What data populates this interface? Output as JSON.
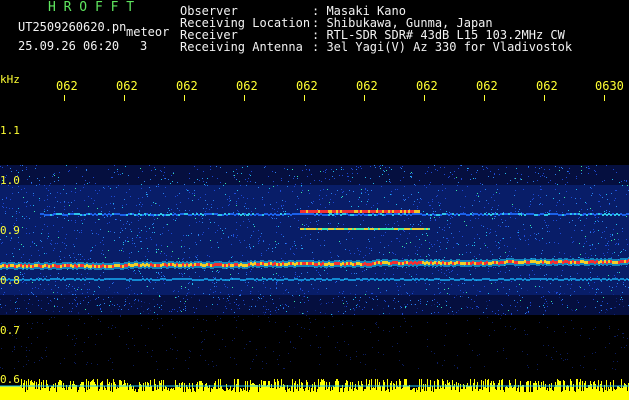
{
  "app_title": "H R O F F T",
  "file_name": "UT2509260620.pn",
  "mode_label": "meteor",
  "date_time": "25.09.26 06:20",
  "count_label": "3",
  "info_labels": [
    "Observer",
    "Receiving Location",
    "Receiver",
    "Receiving Antenna"
  ],
  "info_values": [
    ": Masaki Kano",
    ": Shibukawa, Gunma, Japan",
    ": RTL-SDR SDR# 43dB L15 103.2MHz CW",
    ": 3el Yagi(V) Az 330 for Vladivostok"
  ],
  "time_ticks": [
    "062",
    "062",
    "062",
    "062",
    "062",
    "062",
    "062",
    "062",
    "062",
    "0630"
  ],
  "y_unit": "kHz",
  "y_ticks": [
    "1.1",
    "1.0",
    "0.9",
    "0.8",
    "0.7",
    "0.6"
  ],
  "colors": {
    "background": "#000000",
    "title": "#5fe65f",
    "text": "#f2f2f2",
    "axis": "#ffff33",
    "noise_floor": "#ffff00",
    "signal_peak": "#ff2020"
  }
}
